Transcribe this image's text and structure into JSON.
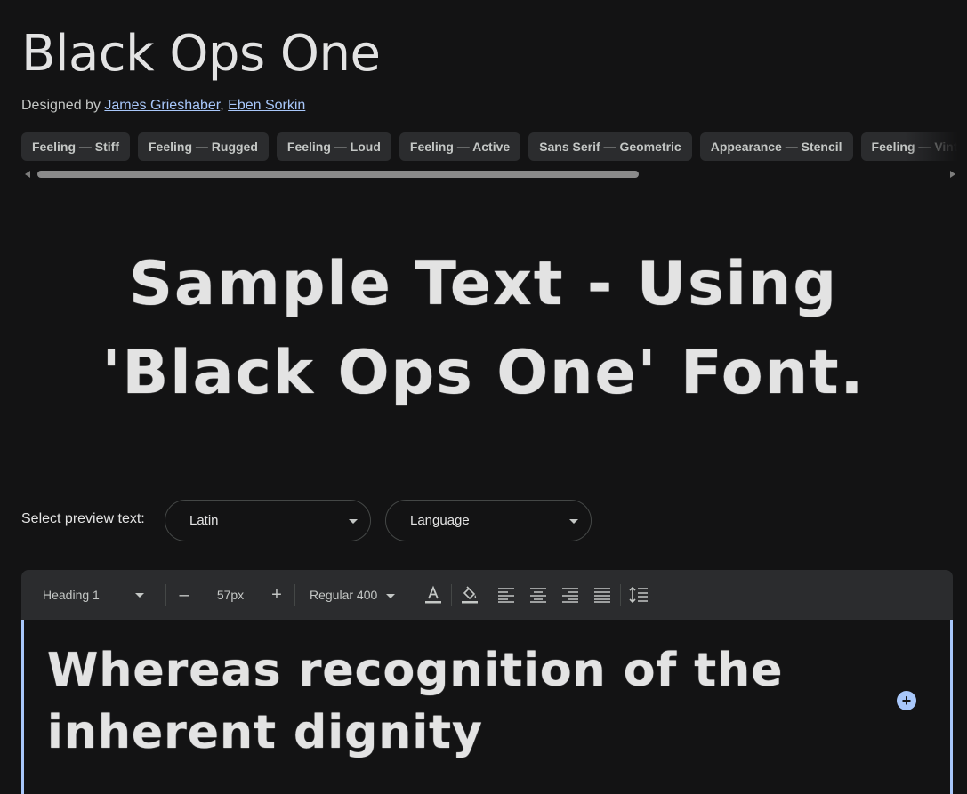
{
  "font": {
    "title": "Black Ops One",
    "designed_by_label": "Designed by",
    "designers": [
      "James Grieshaber",
      "Eben Sorkin"
    ],
    "designer_separator": ","
  },
  "tags": [
    "Feeling — Stiff",
    "Feeling — Rugged",
    "Feeling — Loud",
    "Feeling — Active",
    "Sans Serif — Geometric",
    "Appearance — Stencil",
    "Feeling — Vintage"
  ],
  "sample_text": {
    "line1": "Sample Text - Using",
    "line2": "'Black Ops One' Font."
  },
  "preview": {
    "label": "Select preview text:",
    "script_value": "Latin",
    "language_value": "Language"
  },
  "toolbar": {
    "style_value": "Heading 1",
    "decrease_label": "–",
    "size_value": "57px",
    "increase_label": "+",
    "weight_value": "Regular 400",
    "icons": [
      "text-color-icon",
      "highlight-icon",
      "align-left-icon",
      "align-center-icon",
      "align-right-icon",
      "align-justify-icon",
      "line-height-icon"
    ]
  },
  "editor": {
    "line1": "Whereas recognition of the",
    "line2": "inherent dignity",
    "add_label": "+"
  },
  "colors": {
    "background": "#131314",
    "surface": "#2b2c2e",
    "accent": "#a8c7fa",
    "text": "#e3e3e3"
  }
}
